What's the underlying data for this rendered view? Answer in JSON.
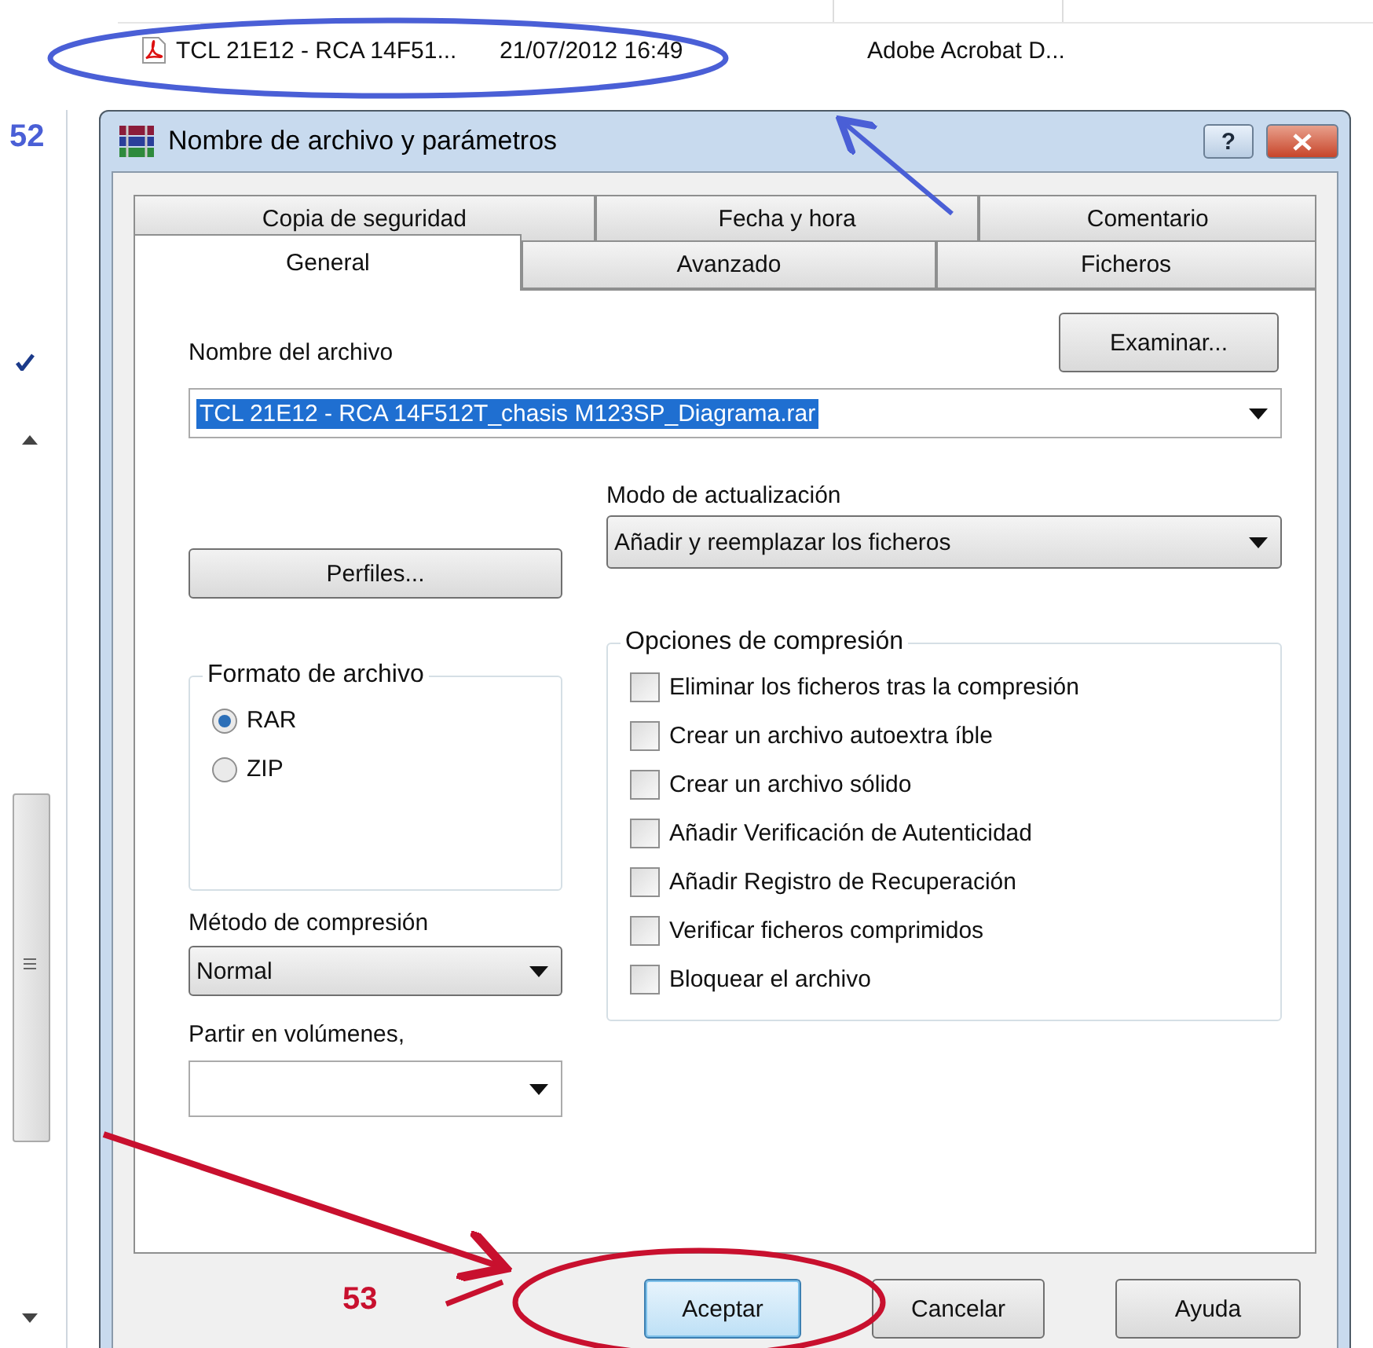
{
  "background_list": {
    "row": {
      "name": "TCL 21E12 - RCA 14F51...",
      "date": "21/07/2012 16:49",
      "type": "Adobe Acrobat D..."
    }
  },
  "annotations": [
    {
      "kind": "ellipse",
      "color": "#4a5fd6",
      "label": "52"
    },
    {
      "kind": "arrow",
      "color": "#c8102e",
      "label": "53"
    }
  ],
  "window": {
    "title": "Nombre de archivo y parámetros",
    "help_button": "?"
  },
  "tab_rows": [
    {
      "tabs": [
        {
          "label": "Copia de seguridad",
          "selected": false
        },
        {
          "label": "Fecha y hora",
          "selected": false
        },
        {
          "label": "Comentario",
          "selected": false
        }
      ]
    },
    {
      "tabs": [
        {
          "label": "General",
          "selected": true
        },
        {
          "label": "Avanzado",
          "selected": false
        },
        {
          "label": "Ficheros",
          "selected": false
        }
      ]
    }
  ],
  "archive_name": {
    "label": "Nombre del archivo",
    "value": "TCL 21E12 - RCA 14F512T_chasis M123SP_Diagrama.rar",
    "browse_button": "Examinar..."
  },
  "profiles_button": "Perfiles...",
  "update_mode": {
    "label": "Modo de actualización",
    "value": "Añadir y reemplazar los ficheros"
  },
  "archive_format": {
    "label": "Formato de archivo",
    "options": [
      {
        "label": "RAR",
        "selected": true
      },
      {
        "label": "ZIP",
        "selected": false
      }
    ]
  },
  "compression_method": {
    "label": "Método de compresión",
    "value": "Normal"
  },
  "split_volumes": {
    "label": "Partir en volúmenes,"
  },
  "compression_options": {
    "label": "Opciones de compresión",
    "items": [
      {
        "label": "Eliminar los ficheros tras la compresión",
        "checked": false
      },
      {
        "label": "Crear un archivo autoextra íble",
        "checked": false
      },
      {
        "label": "Crear un archivo sólido",
        "checked": false
      },
      {
        "label": "Añadir Verificación de Autenticidad",
        "checked": false
      },
      {
        "label": "Añadir Registro de Recuperación",
        "checked": false
      },
      {
        "label": "Verificar ficheros comprimidos",
        "checked": false
      },
      {
        "label": "Bloquear el archivo",
        "checked": false
      }
    ]
  },
  "buttons": [
    {
      "label": "Aceptar",
      "selected": true
    },
    {
      "label": "Cancelar",
      "selected": false
    },
    {
      "label": "Ayuda",
      "selected": false
    }
  ]
}
